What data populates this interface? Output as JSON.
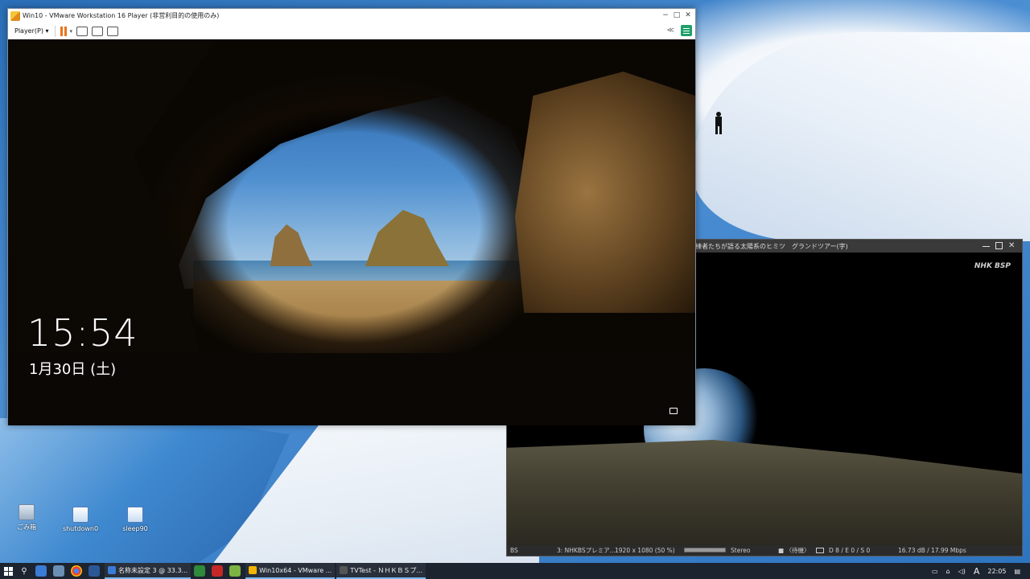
{
  "vmware": {
    "title": "Win10 - VMware Workstation 16 Player (非営利目的の使用のみ)",
    "menu_label": "Player(P)",
    "minimize": "−",
    "maximize": "□",
    "close": "✕",
    "collapse": "≪",
    "lock_screen": {
      "time": "15:54",
      "date": "1月30日 (土)"
    }
  },
  "tvtest": {
    "title": "棟者たちが語る太陽系のヒミツ　グランドツアー(字)",
    "channel_logo": "NHK BSP",
    "status": {
      "tuner": "BS",
      "channel": "3: NHKBSプレミア…",
      "resolution": "1920 x 1080 (50 %)",
      "audio": "Stereo",
      "recording": "■ 〈待機〉",
      "errors": "D 8 / E 0 / S 0",
      "signal": "16.73 dB / 17.99 Mbps"
    }
  },
  "desktop_icons": [
    {
      "label": "ごみ箱"
    },
    {
      "label": "shutdown0"
    },
    {
      "label": "sleep90"
    }
  ],
  "taskbar": {
    "apps": [
      {
        "label": "名称未設定 3 @ 33.3...",
        "color": "#3a7bd5"
      },
      {
        "label": "Win10x64 - VMware ...",
        "color": "#f4b400"
      },
      {
        "label": "TVTest - ＮＨＫＢＳプ...",
        "color": "#555555"
      }
    ],
    "ime": "A",
    "clock": "22:05"
  }
}
